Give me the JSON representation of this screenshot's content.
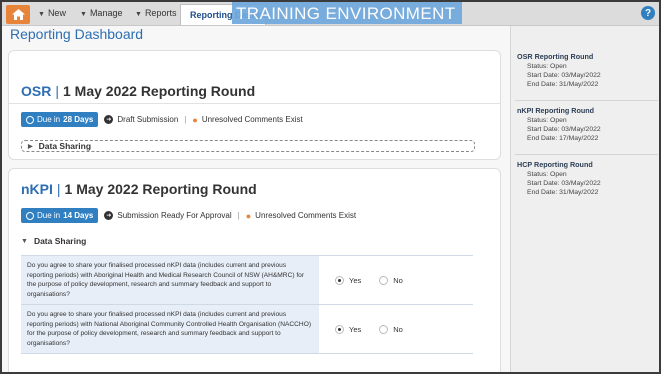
{
  "nav": {
    "new_label": "New",
    "manage_label": "Manage",
    "reports_label": "Reports",
    "active_tab_label": "Reporting Dashboard",
    "banner_text": "TRAINING ENVIRONMENT",
    "help_glyph": "?"
  },
  "page": {
    "title": "Reporting Dashboard"
  },
  "osr_card": {
    "program": "OSR",
    "round": "1 May 2022 Reporting Round",
    "due_prefix": "Due in",
    "due_days": "28 Days",
    "status": "Draft Submission",
    "comments": "Unresolved Comments Exist",
    "section_label": "Data Sharing"
  },
  "nkpi_card": {
    "program": "nKPI",
    "round": "1 May 2022 Reporting Round",
    "due_prefix": "Due in",
    "due_days": "14 Days",
    "status": "Submission Ready For Approval",
    "comments": "Unresolved Comments Exist",
    "section_label": "Data Sharing",
    "questions": [
      {
        "text": "Do you agree to share your finalised processed nKPI data (includes current and previous reporting periods) with Aboriginal Health and Medical Research Council of NSW (AH&MRC) for the purpose of policy development, research and summary feedback and support to organisations?",
        "yes_label": "Yes",
        "no_label": "No",
        "selected": "Yes"
      },
      {
        "text": "Do you agree to share your finalised processed nKPI data (includes current and previous reporting periods) with National Aboriginal Community Controlled Health Organisation (NACCHO) for the purpose of policy development, research and summary feedback and support to organisations?",
        "yes_label": "Yes",
        "no_label": "No",
        "selected": "Yes"
      }
    ]
  },
  "side_panel": {
    "rounds": [
      {
        "title": "OSR Reporting Round",
        "status": "Status: Open",
        "start": "Start Date: 03/May/2022",
        "end": "End Date: 31/May/2022"
      },
      {
        "title": "nKPI Reporting Round",
        "status": "Status: Open",
        "start": "Start Date: 03/May/2022",
        "end": "End Date: 17/May/2022"
      },
      {
        "title": "HCP Reporting Round",
        "status": "Status: Open",
        "start": "Start Date: 03/May/2022",
        "end": "End Date: 31/May/2022"
      }
    ]
  },
  "colors": {
    "brand_orange": "#e8833a",
    "link_blue": "#2d6eb2",
    "badge_blue": "#2f7fc1",
    "banner_blue": "#6fa8dc"
  }
}
